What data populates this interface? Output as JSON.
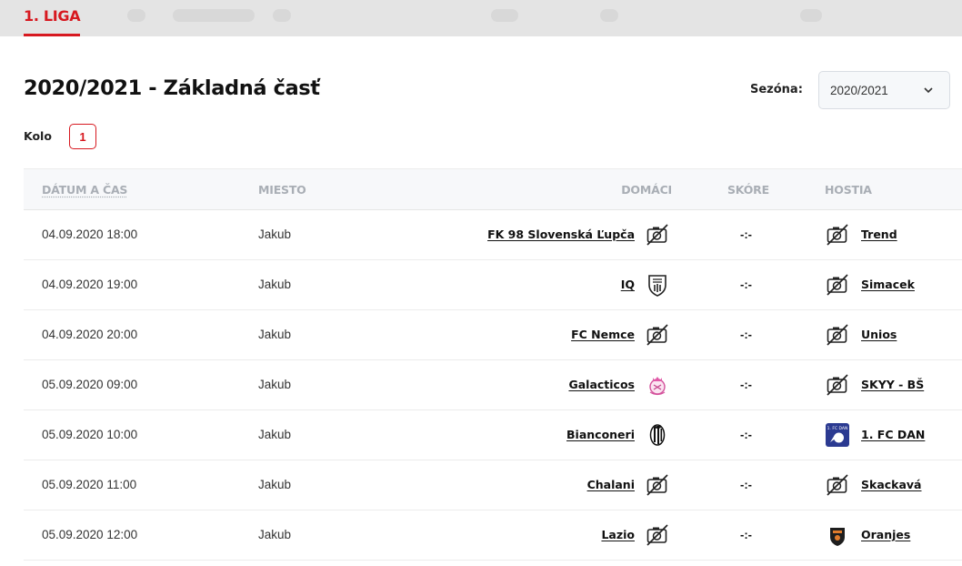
{
  "league_tab": "1. LIGA",
  "page_title": "2020/2021 - Základná časť",
  "season": {
    "label": "Sezóna:",
    "value": "2020/2021"
  },
  "round": {
    "label": "Kolo",
    "value": "1"
  },
  "columns": {
    "date": "DÁTUM A ČAS",
    "place": "MIESTO",
    "home": "DOMÁCI",
    "score": "SKÓRE",
    "away": "HOSTIA"
  },
  "colors": {
    "accent": "#d71920",
    "header_text": "#a9aeb5"
  },
  "matches": [
    {
      "date": "04.09.2020 18:00",
      "place": "Jakub",
      "home": "FK 98 Slovenská Ľupča",
      "home_logo": "no-image-icon",
      "score": "-:-",
      "away": "Trend",
      "away_logo": "no-image-icon"
    },
    {
      "date": "04.09.2020 19:00",
      "place": "Jakub",
      "home": "IQ",
      "home_logo": "iq-crest-icon",
      "score": "-:-",
      "away": "Simacek",
      "away_logo": "no-image-icon"
    },
    {
      "date": "04.09.2020 20:00",
      "place": "Jakub",
      "home": "FC Nemce",
      "home_logo": "no-image-icon",
      "score": "-:-",
      "away": "Unios",
      "away_logo": "no-image-icon"
    },
    {
      "date": "05.09.2020 09:00",
      "place": "Jakub",
      "home": "Galacticos",
      "home_logo": "galacticos-crest-icon",
      "score": "-:-",
      "away": "SKYY - BŠ",
      "away_logo": "no-image-icon"
    },
    {
      "date": "05.09.2020 10:00",
      "place": "Jakub",
      "home": "Bianconeri",
      "home_logo": "bianconeri-crest-icon",
      "score": "-:-",
      "away": "1. FC DAN",
      "away_logo": "fc-dan-crest-icon"
    },
    {
      "date": "05.09.2020 11:00",
      "place": "Jakub",
      "home": "Chalani",
      "home_logo": "no-image-icon",
      "score": "-:-",
      "away": "Skackavá",
      "away_logo": "no-image-icon"
    },
    {
      "date": "05.09.2020 12:00",
      "place": "Jakub",
      "home": "Lazio",
      "home_logo": "no-image-icon",
      "score": "-:-",
      "away": "Oranjes",
      "away_logo": "oranjes-crest-icon"
    }
  ]
}
